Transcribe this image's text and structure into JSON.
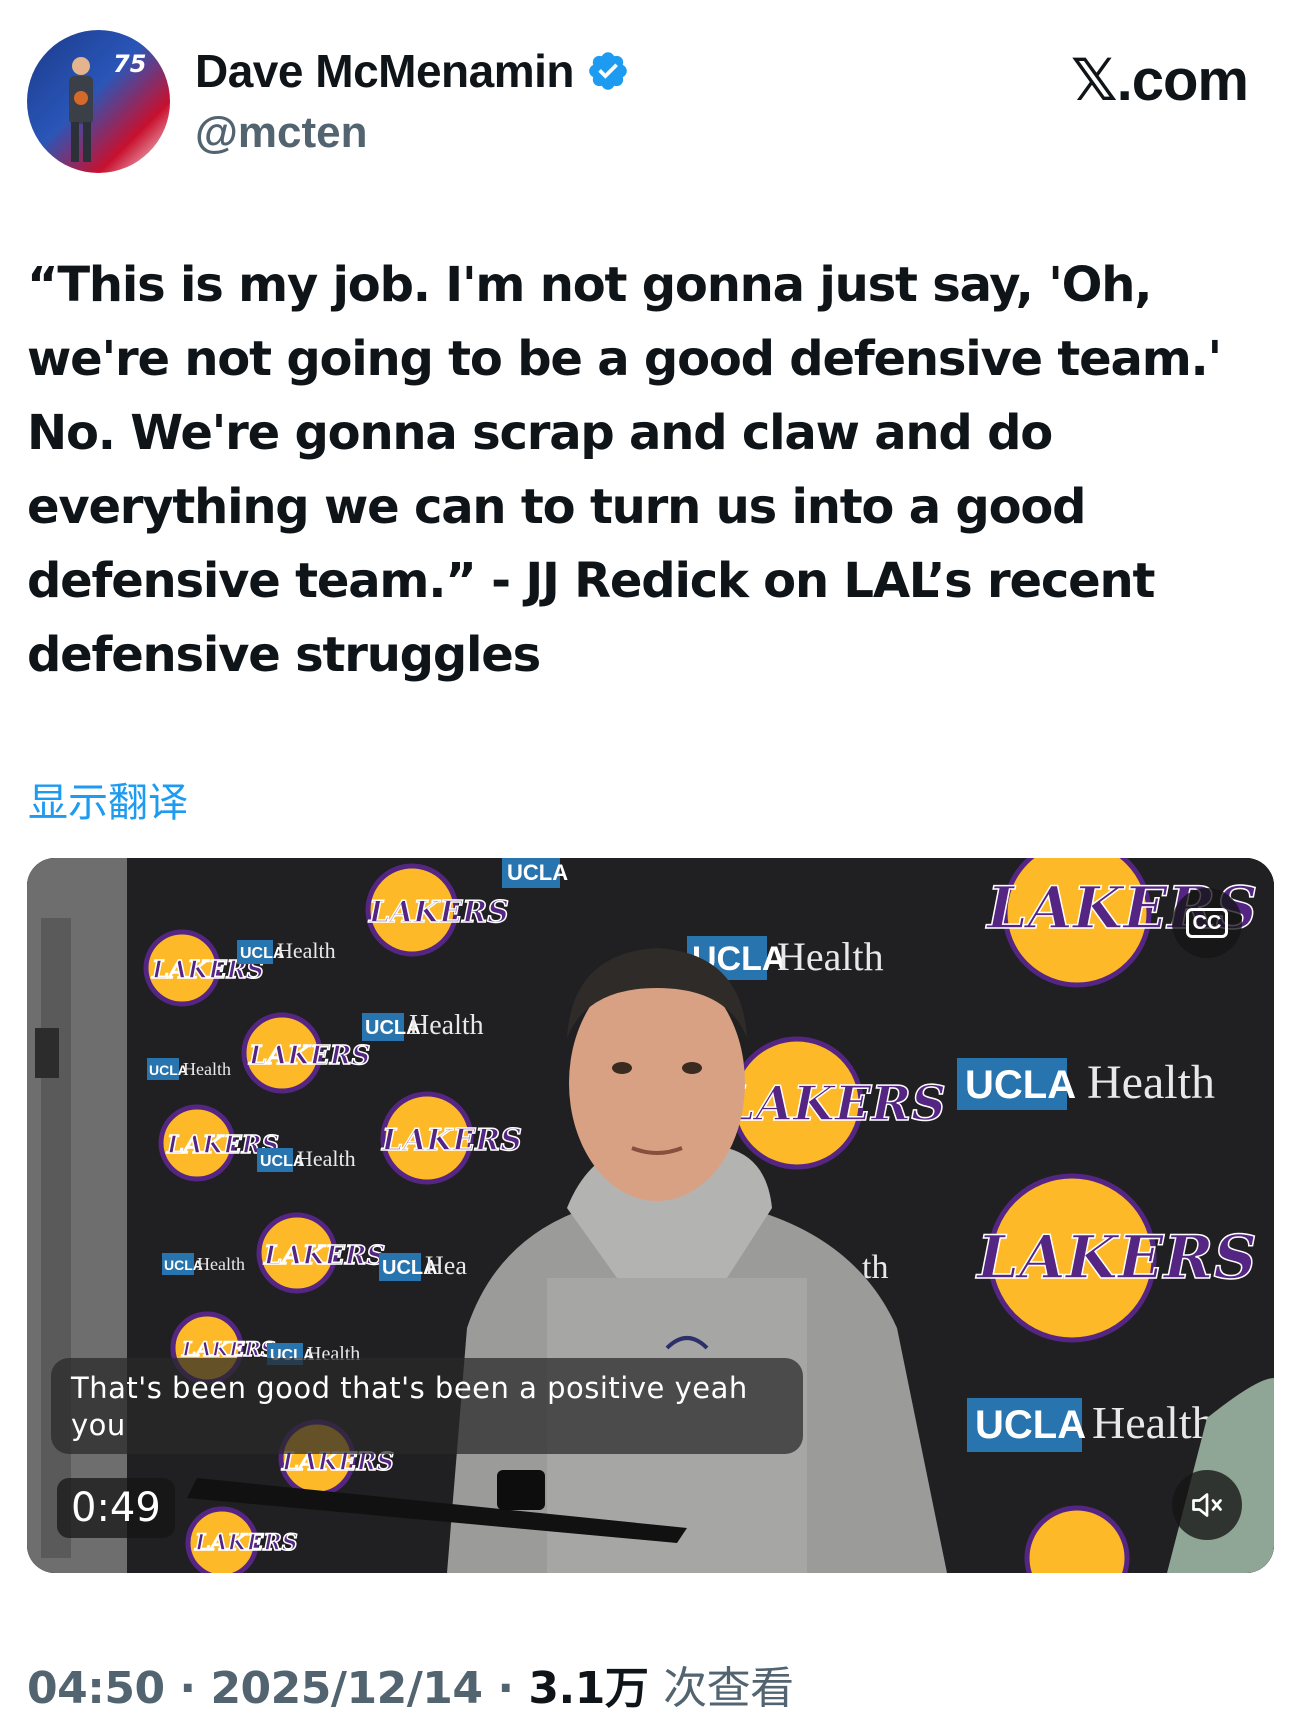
{
  "author": {
    "display_name": "Dave McMenamin",
    "handle": "@mcten",
    "verified": true,
    "avatar_icon": "nba-75-avatar-icon"
  },
  "brand": {
    "label": "𝕏.com"
  },
  "tweet": {
    "text": "“This is my job. I'm not gonna just say, 'Oh, we're not going to be a good defensive team.' No. We're gonna scrap and claw and do everything we can to turn us into a good defensive team.” - JJ Redick on LAL’s recent defensive struggles",
    "translate_label": "显示翻译"
  },
  "video": {
    "caption": "That's been good that's been a positive yeah you",
    "duration": "0:49",
    "cc_label": "CC",
    "muted": true,
    "backdrop_brands": [
      "LAKERS",
      "UCLA",
      "Health"
    ]
  },
  "meta": {
    "time": "04:50",
    "separator": "·",
    "date": "2025/12/14",
    "views_count": "3.1万",
    "views_label": "次查看"
  },
  "colors": {
    "link": "#1d9bf0",
    "verified": "#1d9bf0",
    "lakers_purple": "#552583",
    "lakers_gold": "#fdb927",
    "ucla_blue": "#2774ae",
    "secondary_text": "#536471"
  }
}
